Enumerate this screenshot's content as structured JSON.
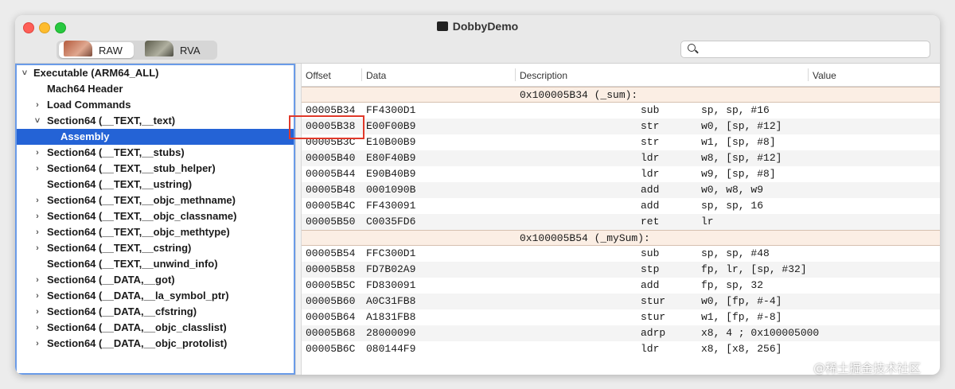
{
  "window": {
    "title": "DobbyDemo"
  },
  "toolbar": {
    "raw_label": "RAW",
    "rva_label": "RVA",
    "search_placeholder": ""
  },
  "tree": [
    {
      "label": "Executable  (ARM64_ALL)",
      "chevron": "˅",
      "indent": 0
    },
    {
      "label": "Mach64 Header",
      "chevron": "",
      "indent": 1
    },
    {
      "label": "Load Commands",
      "chevron": "›",
      "indent": 1
    },
    {
      "label": "Section64 (__TEXT,__text)",
      "chevron": "˅",
      "indent": 1
    },
    {
      "label": "Assembly",
      "chevron": "",
      "indent": 2,
      "selected": true
    },
    {
      "label": "Section64 (__TEXT,__stubs)",
      "chevron": "›",
      "indent": 1
    },
    {
      "label": "Section64 (__TEXT,__stub_helper)",
      "chevron": "›",
      "indent": 1
    },
    {
      "label": "Section64 (__TEXT,__ustring)",
      "chevron": "",
      "indent": 1
    },
    {
      "label": "Section64 (__TEXT,__objc_methname)",
      "chevron": "›",
      "indent": 1
    },
    {
      "label": "Section64 (__TEXT,__objc_classname)",
      "chevron": "›",
      "indent": 1
    },
    {
      "label": "Section64 (__TEXT,__objc_methtype)",
      "chevron": "›",
      "indent": 1
    },
    {
      "label": "Section64 (__TEXT,__cstring)",
      "chevron": "›",
      "indent": 1
    },
    {
      "label": "Section64 (__TEXT,__unwind_info)",
      "chevron": "",
      "indent": 1
    },
    {
      "label": "Section64 (__DATA,__got)",
      "chevron": "›",
      "indent": 1
    },
    {
      "label": "Section64 (__DATA,__la_symbol_ptr)",
      "chevron": "›",
      "indent": 1
    },
    {
      "label": "Section64 (__DATA,__cfstring)",
      "chevron": "›",
      "indent": 1
    },
    {
      "label": "Section64 (__DATA,__objc_classlist)",
      "chevron": "›",
      "indent": 1
    },
    {
      "label": "Section64 (__DATA,__objc_protolist)",
      "chevron": "›",
      "indent": 1
    }
  ],
  "columns": [
    "Offset",
    "Data",
    "Description",
    "Value"
  ],
  "rows": [
    {
      "type": "header",
      "text": "0x100005B34 (_sum):"
    },
    {
      "offset": "00005B34",
      "data": "FF4300D1",
      "mnemonic": "sub",
      "operands": "sp, sp, #16"
    },
    {
      "offset": "00005B38",
      "data": "E00F00B9",
      "mnemonic": "str",
      "operands": "w0, [sp, #12]"
    },
    {
      "offset": "00005B3C",
      "data": "E10B00B9",
      "mnemonic": "str",
      "operands": "w1, [sp, #8]"
    },
    {
      "offset": "00005B40",
      "data": "E80F40B9",
      "mnemonic": "ldr",
      "operands": "w8, [sp, #12]"
    },
    {
      "offset": "00005B44",
      "data": "E90B40B9",
      "mnemonic": "ldr",
      "operands": "w9, [sp, #8]"
    },
    {
      "offset": "00005B48",
      "data": "0001090B",
      "mnemonic": "add",
      "operands": "w0, w8, w9"
    },
    {
      "offset": "00005B4C",
      "data": "FF430091",
      "mnemonic": "add",
      "operands": "sp, sp, 16"
    },
    {
      "offset": "00005B50",
      "data": "C0035FD6",
      "mnemonic": "ret",
      "operands": "lr"
    },
    {
      "type": "header",
      "text": "0x100005B54 (_mySum):"
    },
    {
      "offset": "00005B54",
      "data": "FFC300D1",
      "mnemonic": "sub",
      "operands": "sp, sp, #48"
    },
    {
      "offset": "00005B58",
      "data": "FD7B02A9",
      "mnemonic": "stp",
      "operands": "fp, lr, [sp, #32]"
    },
    {
      "offset": "00005B5C",
      "data": "FD830091",
      "mnemonic": "add",
      "operands": "fp, sp, 32"
    },
    {
      "offset": "00005B60",
      "data": "A0C31FB8",
      "mnemonic": "stur",
      "operands": "w0, [fp, #-4]"
    },
    {
      "offset": "00005B64",
      "data": "A1831FB8",
      "mnemonic": "stur",
      "operands": "w1, [fp, #-8]"
    },
    {
      "offset": "00005B68",
      "data": "28000090",
      "mnemonic": "adrp",
      "operands": "x8, 4 ; 0x100005000"
    },
    {
      "offset": "00005B6C",
      "data": "080144F9",
      "mnemonic": "ldr",
      "operands": "x8, [x8, 256]"
    }
  ],
  "watermark": "@稀土掘金技术社区"
}
